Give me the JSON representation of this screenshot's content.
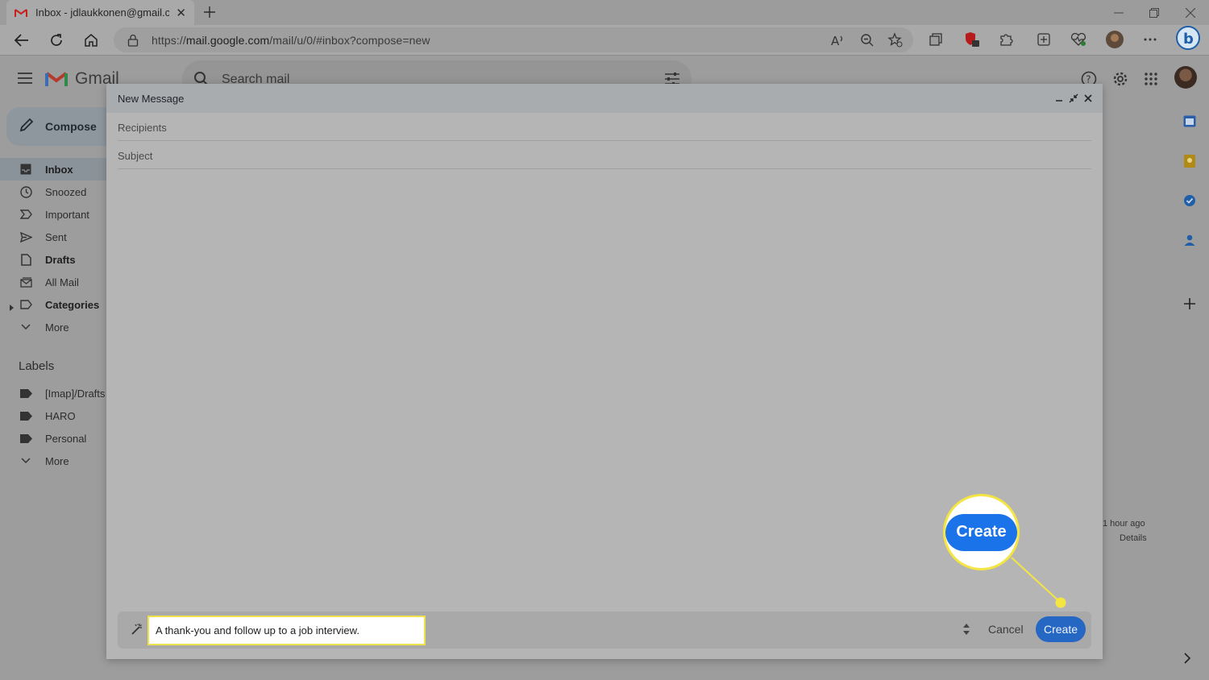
{
  "browser": {
    "tab_title": "Inbox - jdlaukkonen@gmail.com",
    "url_prefix": "https://",
    "url_host": "mail.google.com",
    "url_path": "/mail/u/0/#inbox?compose=new"
  },
  "gmail": {
    "logo_text": "Gmail",
    "search_placeholder": "Search mail",
    "compose_label": "Compose",
    "nav": [
      {
        "label": "Inbox",
        "bold": true,
        "active": true,
        "icon": "inbox-icon"
      },
      {
        "label": "Snoozed",
        "icon": "clock-icon"
      },
      {
        "label": "Important",
        "icon": "important-icon"
      },
      {
        "label": "Sent",
        "icon": "send-icon"
      },
      {
        "label": "Drafts",
        "bold": true,
        "icon": "draft-icon"
      },
      {
        "label": "All Mail",
        "icon": "all-mail-icon"
      },
      {
        "label": "Categories",
        "bold": true,
        "icon": "label-icon"
      },
      {
        "label": "More",
        "icon": "chevron-down-icon"
      }
    ],
    "labels_heading": "Labels",
    "labels": [
      {
        "label": "[Imap]/Drafts"
      },
      {
        "label": "HARO"
      },
      {
        "label": "Personal"
      },
      {
        "label": "More"
      }
    ],
    "bg_time": "1 hour ago",
    "bg_details": "Details"
  },
  "compose": {
    "title": "New Message",
    "recipients_placeholder": "Recipients",
    "subject_placeholder": "Subject",
    "prompt_text": "A thank-you and follow up to a job interview.",
    "cancel_label": "Cancel",
    "create_label": "Create"
  },
  "callout": {
    "label": "Create"
  },
  "colors": {
    "accent_blue": "#1a73e8",
    "highlight_yellow": "#f5e542",
    "gmail_red": "#ea4335"
  }
}
